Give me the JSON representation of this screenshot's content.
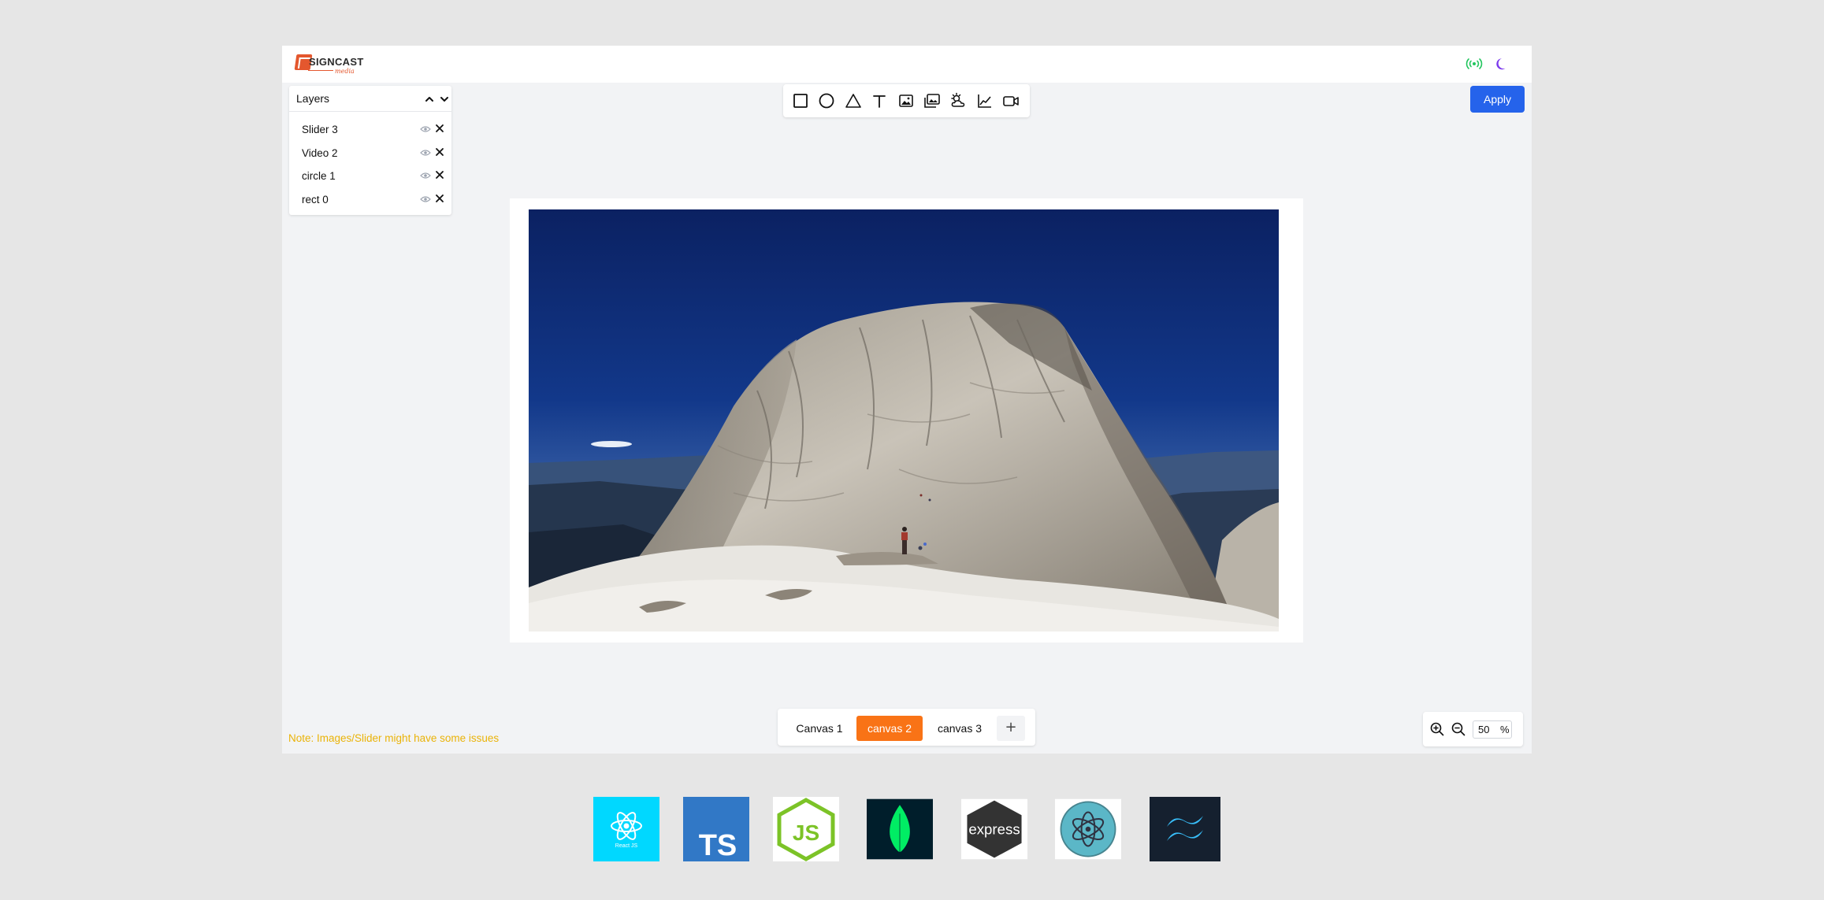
{
  "brand": {
    "name": "SIGNCAST",
    "tagline": "media"
  },
  "header": {
    "broadcast_icon": "broadcast-icon",
    "theme_icon": "moon-icon",
    "colors": {
      "broadcast": "#22c55e",
      "moon": "#7c3aed"
    }
  },
  "layers": {
    "title": "Layers",
    "items": [
      {
        "label": "Slider 3"
      },
      {
        "label": "Video 2"
      },
      {
        "label": "circle 1"
      },
      {
        "label": "rect 0"
      }
    ]
  },
  "toolbar": {
    "tools": [
      "rectangle-icon",
      "circle-icon",
      "triangle-icon",
      "text-icon",
      "image-icon",
      "gallery-icon",
      "weather-icon",
      "chart-icon",
      "video-icon"
    ]
  },
  "actions": {
    "apply_label": "Apply"
  },
  "canvas_tabs": {
    "tabs": [
      {
        "label": "Canvas 1",
        "active": false
      },
      {
        "label": "canvas 2",
        "active": true
      },
      {
        "label": "canvas 3",
        "active": false
      }
    ],
    "add_label": "+"
  },
  "zoom": {
    "value": "50",
    "unit": "%"
  },
  "note": "Note: Images/Slider might have some issues",
  "tech_stack": [
    {
      "name": "react-js-logo",
      "caption": "React JS"
    },
    {
      "name": "typescript-logo",
      "caption": "TS"
    },
    {
      "name": "nodejs-logo",
      "caption": "JS"
    },
    {
      "name": "mongodb-logo"
    },
    {
      "name": "express-logo",
      "caption": "express"
    },
    {
      "name": "electron-logo"
    },
    {
      "name": "tailwind-logo"
    }
  ],
  "colors": {
    "accent": "#2563eb",
    "active_tab": "#f97316",
    "note": "#eab308"
  }
}
